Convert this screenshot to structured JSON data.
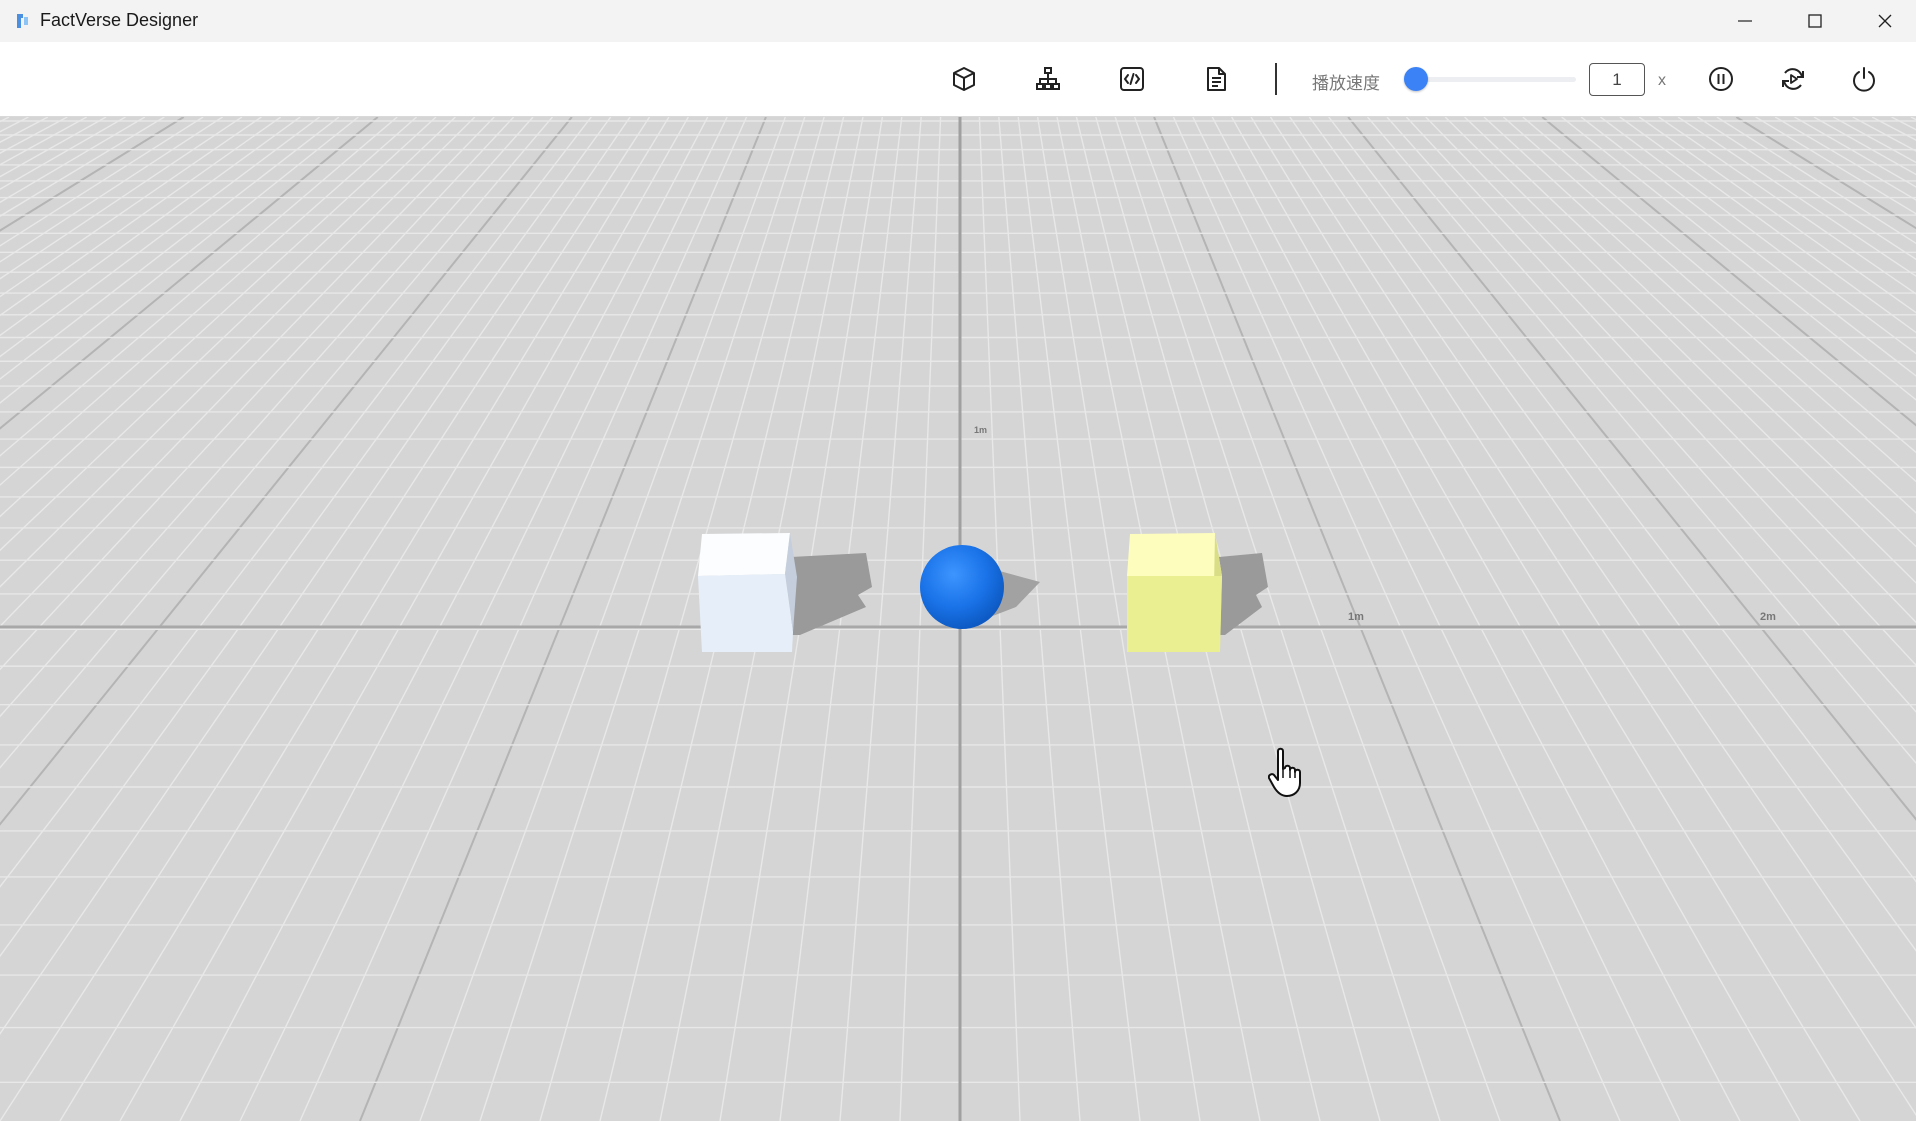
{
  "window": {
    "title": "FactVerse Designer",
    "controls": [
      "minimize-icon",
      "maximize-icon",
      "close-icon"
    ]
  },
  "toolbar": {
    "icons": [
      "cube-icon",
      "hierarchy-icon",
      "code-icon",
      "document-icon"
    ],
    "speed_label": "播放速度",
    "speed_value": "1",
    "speed_unit": "x",
    "speed_slider_fraction": 0.0,
    "action_icons": [
      "pause-icon",
      "restart-icon",
      "power-icon"
    ],
    "accent_color": "#3b82f6"
  },
  "viewport": {
    "axis_labels": {
      "x_1m": "1m",
      "x_2m": "2m",
      "z_1m": "1m"
    },
    "objects": [
      {
        "name": "white-cube",
        "color": "#f2f6fb"
      },
      {
        "name": "blue-sphere",
        "color": "#1a73e8"
      },
      {
        "name": "yellow-cube",
        "color": "#f2f6a6"
      }
    ]
  }
}
